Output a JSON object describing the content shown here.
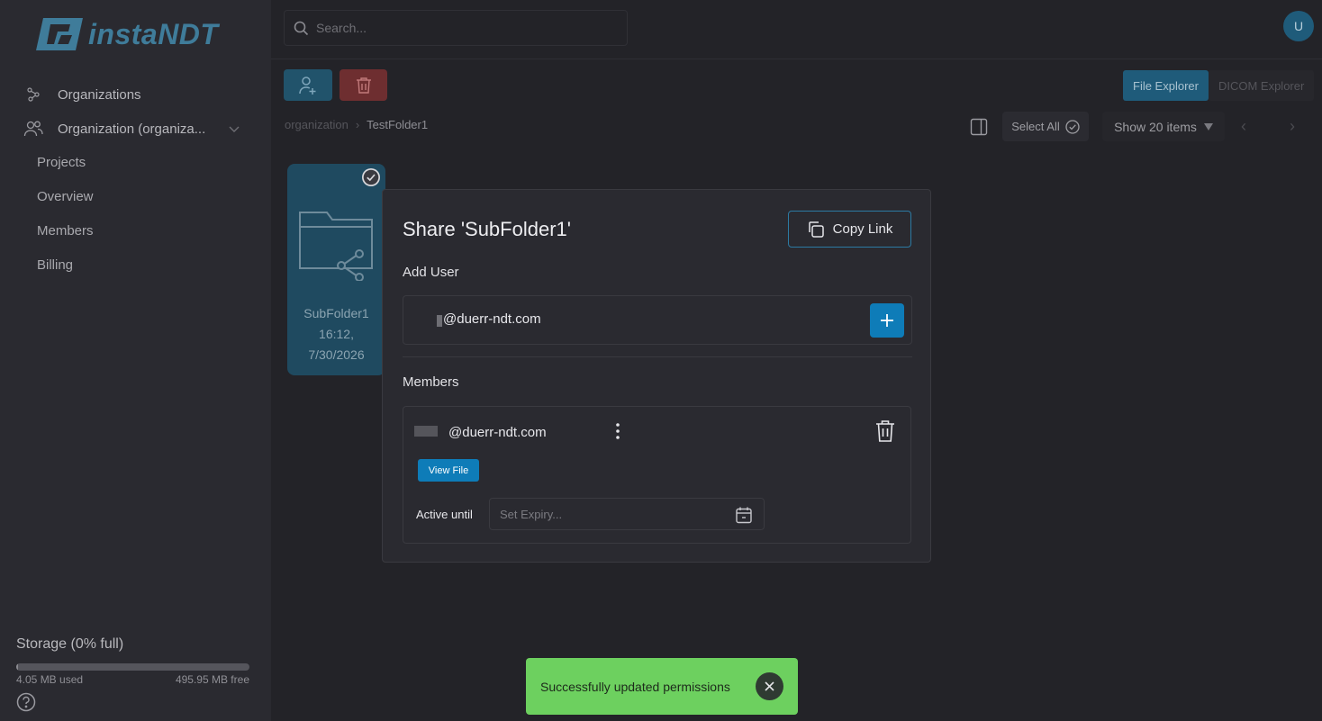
{
  "app": {
    "logo_text": "instaNDT",
    "user_initial": "U"
  },
  "search": {
    "placeholder": "Search..."
  },
  "sidebar": {
    "nav": [
      {
        "label": "Organizations",
        "icon": "org-graph-icon"
      },
      {
        "label": "Organization (organiza...",
        "icon": "users-icon"
      }
    ],
    "sub_items": [
      "Projects",
      "Overview",
      "Members",
      "Billing"
    ],
    "storage": {
      "title": "Storage (0% full)",
      "used": "4.05 MB used",
      "free": "495.95 MB free",
      "percent_full": 0.8
    }
  },
  "toolbar": {
    "view_toggle": [
      "File Explorer",
      "DICOM Explorer"
    ],
    "active_view": "File Explorer",
    "select_all": "Select All",
    "show_items": "Show 20 items"
  },
  "breadcrumb": [
    "organization",
    "TestFolder1"
  ],
  "folder": {
    "name": "SubFolder1",
    "time": "16:12,",
    "date": "7/30/2026"
  },
  "modal": {
    "title": "Share 'SubFolder1'",
    "copy_link": "Copy Link",
    "add_user_label": "Add User",
    "add_user_value": "@duerr-ndt.com",
    "members_label": "Members",
    "member": {
      "email": "@duerr-ndt.com",
      "permission": "View File",
      "active_until_label": "Active until",
      "expiry_placeholder": "Set Expiry..."
    }
  },
  "toast": {
    "message": "Successfully updated permissions"
  },
  "colors": {
    "accent": "#0e7cb8",
    "toast_bg": "#6dd05f",
    "danger": "#6e2e30"
  }
}
